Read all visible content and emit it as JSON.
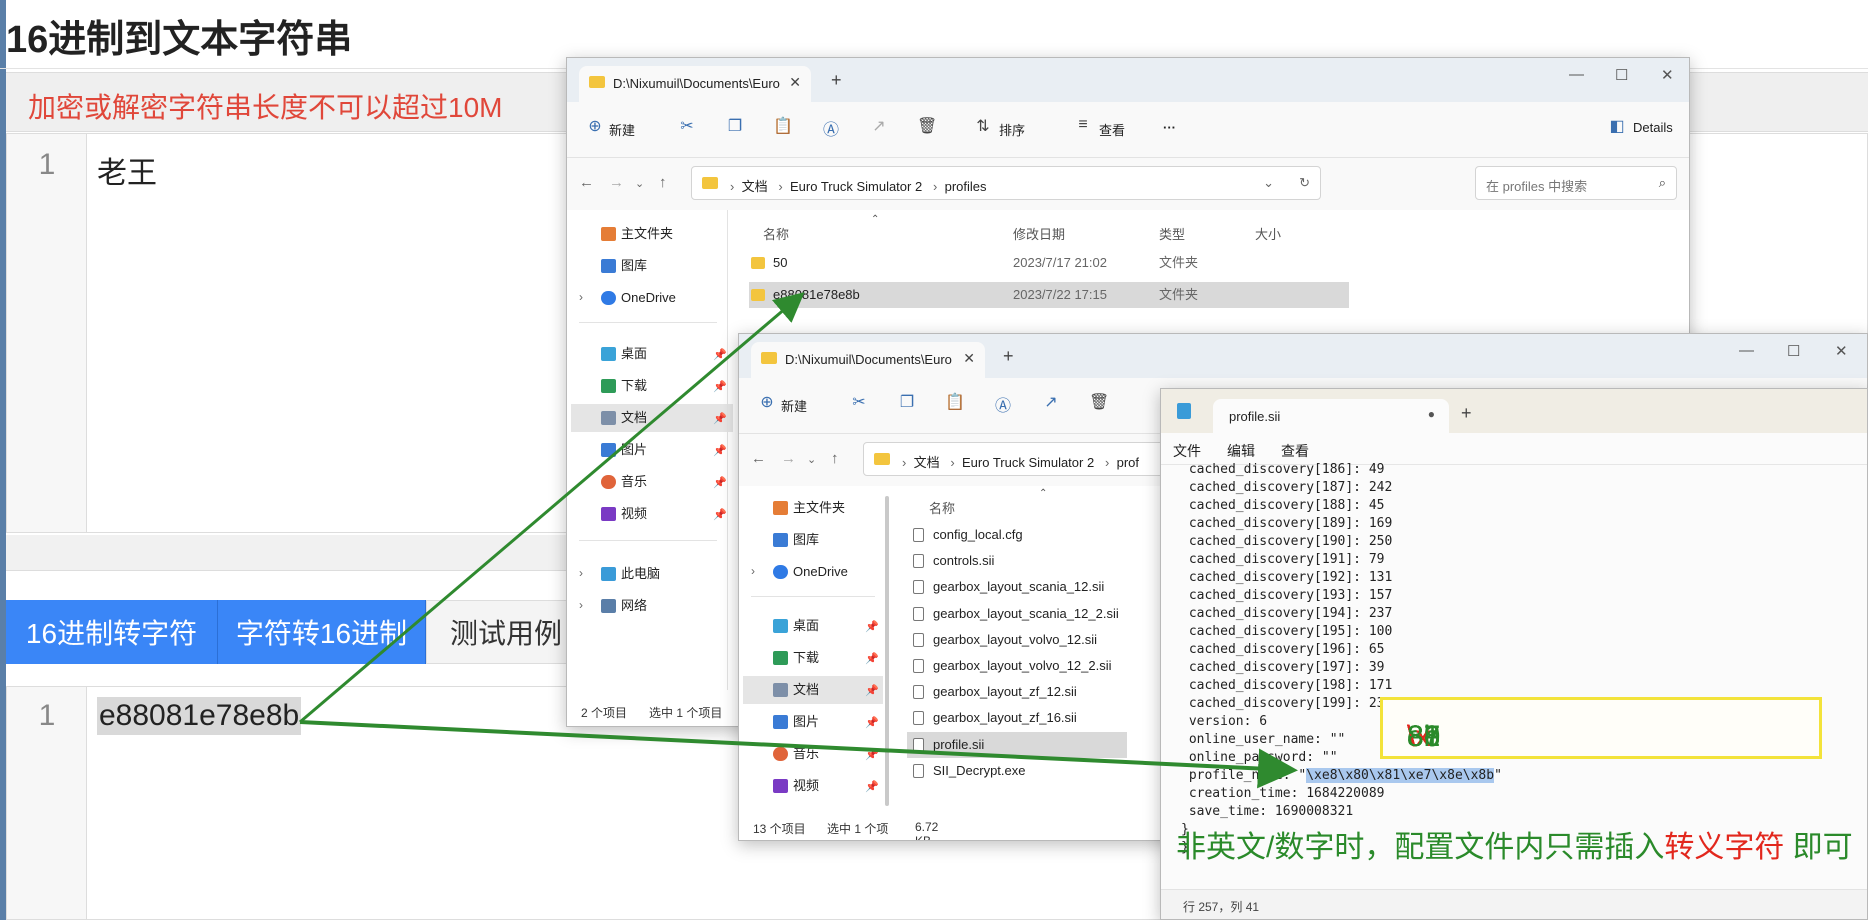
{
  "page": {
    "title": "16进制到文本字符串",
    "notice": "加密或解密字符串长度不可以超过10M",
    "input_editor": {
      "line_number": "1",
      "content": "老王"
    },
    "buttons": {
      "hex_to_text": "16进制转字符",
      "text_to_hex": "字符转16进制",
      "test_cases": "测试用例"
    },
    "output_editor": {
      "line_number": "1",
      "content": "e88081e78e8b"
    }
  },
  "explorer1": {
    "tab_title": "D:\\Nixumuil\\Documents\\Euro",
    "toolbar": {
      "new": "新建",
      "sort": "排序",
      "view": "查看",
      "more": "···",
      "details": "Details"
    },
    "breadcrumb": [
      "文档",
      "Euro Truck Simulator 2",
      "profiles"
    ],
    "search_placeholder": "在 profiles 中搜索",
    "nav": {
      "home": "主文件夹",
      "gallery": "图库",
      "onedrive": "OneDrive",
      "desktop": "桌面",
      "downloads": "下载",
      "documents": "文档",
      "pictures": "图片",
      "music": "音乐",
      "videos": "视频",
      "this_pc": "此电脑",
      "network": "网络"
    },
    "columns": {
      "name": "名称",
      "modified": "修改日期",
      "type": "类型",
      "size": "大小"
    },
    "rows": [
      {
        "name": "50",
        "modified": "2023/7/17 21:02",
        "type": "文件夹"
      },
      {
        "name": "e88081e78e8b",
        "modified": "2023/7/22 17:15",
        "type": "文件夹"
      }
    ],
    "status": {
      "count": "2 个项目",
      "selected": "选中 1 个项目"
    }
  },
  "explorer2": {
    "tab_title": "D:\\Nixumuil\\Documents\\Euro",
    "toolbar": {
      "new": "新建"
    },
    "breadcrumb": [
      "文档",
      "Euro Truck Simulator 2",
      "prof"
    ],
    "nav": {
      "home": "主文件夹",
      "gallery": "图库",
      "onedrive": "OneDrive",
      "desktop": "桌面",
      "downloads": "下载",
      "documents": "文档",
      "pictures": "图片",
      "music": "音乐",
      "videos": "视频"
    },
    "columns": {
      "name": "名称"
    },
    "files": [
      "config_local.cfg",
      "controls.sii",
      "gearbox_layout_scania_12.sii",
      "gearbox_layout_scania_12_2.sii",
      "gearbox_layout_volvo_12.sii",
      "gearbox_layout_volvo_12_2.sii",
      "gearbox_layout_zf_12.sii",
      "gearbox_layout_zf_16.sii",
      "profile.sii",
      "SII_Decrypt.exe"
    ],
    "status": {
      "count": "13 个项目",
      "selected": "选中 1 个项目",
      "size": "6.72 KB"
    }
  },
  "notepad": {
    "tab_title": "profile.sii",
    "menu": {
      "file": "文件",
      "edit": "编辑",
      "view": "查看"
    },
    "lines": [
      " cached_discovery[186]: 49",
      " cached_discovery[187]: 242",
      " cached_discovery[188]: 45",
      " cached_discovery[189]: 169",
      " cached_discovery[190]: 250",
      " cached_discovery[191]: 79",
      " cached_discovery[192]: 131",
      " cached_discovery[193]: 157",
      " cached_discovery[194]: 237",
      " cached_discovery[195]: 100",
      " cached_discovery[196]: 65",
      " cached_discovery[197]: 39",
      " cached_discovery[198]: 171",
      " cached_discovery[199]: 237",
      " version: 6",
      " online_user_name: \"\"",
      " online_password: \"\"",
      " profile_name: \"",
      " creation_time: 1684220089",
      " save_time: 1690008321",
      "}",
      "",
      "}"
    ],
    "highlight_value": "\\xe8\\x80\\x81\\xe7\\x8e\\x8b",
    "status": "行 257，列 41"
  },
  "annotations": {
    "hex_escape": [
      "\\x",
      "e8",
      "\\x",
      "80",
      "\\x",
      "81",
      "\\x",
      "e7",
      "\\x",
      " 8e",
      "\\x",
      " 8b"
    ],
    "note_green_1": "非英文/数字时，配置文件内只需插入",
    "note_red": "转义字符",
    "note_green_2": " 即可"
  },
  "colors": {
    "accent_blue": "#3a86f7",
    "notice_red": "#e0473a",
    "arrow_green": "#2f8a2f",
    "callout_yellow": "#f3e33a"
  }
}
